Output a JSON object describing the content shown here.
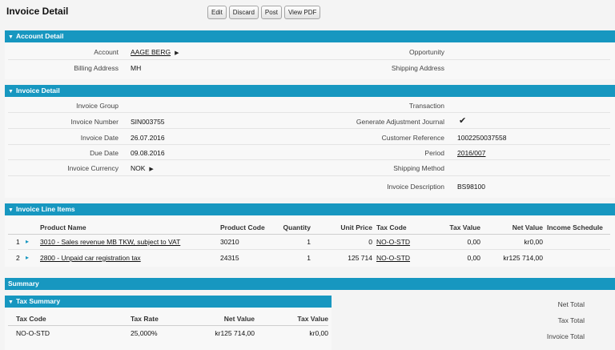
{
  "page": {
    "title": "Invoice Detail",
    "buttons": {
      "edit": "Edit",
      "discard": "Discard",
      "post": "Post",
      "view_pdf": "View PDF"
    }
  },
  "account_detail": {
    "header": "Account Detail",
    "account_label": "Account",
    "account_value": "AAGE BERG",
    "billing_label": "Billing Address",
    "billing_value": "MH",
    "opportunity_label": "Opportunity",
    "shipping_address_label": "Shipping Address"
  },
  "invoice_detail": {
    "header": "Invoice Detail",
    "group_label": "Invoice Group",
    "number_label": "Invoice Number",
    "number_value": "SIN003755",
    "date_label": "Invoice Date",
    "date_value": "26.07.2016",
    "due_label": "Due Date",
    "due_value": "09.08.2016",
    "currency_label": "Invoice Currency",
    "currency_value": "NOK",
    "transaction_label": "Transaction",
    "gen_adj_label": "Generate Adjustment Journal",
    "cust_ref_label": "Customer Reference",
    "cust_ref_value": "1002250037558",
    "period_label": "Period",
    "period_value": "2016/007",
    "ship_method_label": "Shipping Method",
    "description_label": "Invoice Description",
    "description_value": "BS98100"
  },
  "line_items": {
    "header": "Invoice Line Items",
    "columns": {
      "product_name": "Product Name",
      "product_code": "Product Code",
      "quantity": "Quantity",
      "unit_price": "Unit Price",
      "tax_code": "Tax Code",
      "tax_value": "Tax Value",
      "net_value": "Net Value",
      "income_schedule": "Income Schedule"
    },
    "rows": [
      {
        "num": "1",
        "name": "3010 - Sales revenue MB TKW, subject to VAT",
        "code": "30210",
        "qty": "1",
        "unit_price": "0",
        "tax_code": "NO-O-STD",
        "tax_value": "0,00",
        "net_value": "kr0,00"
      },
      {
        "num": "2",
        "name": "2800 - Unpaid car registration tax",
        "code": "24315",
        "qty": "1",
        "unit_price": "125 714",
        "tax_code": "NO-O-STD",
        "tax_value": "0,00",
        "net_value": "kr125 714,00"
      }
    ]
  },
  "summary": {
    "header": "Summary",
    "tax_summary_header": "Tax Summary",
    "columns": {
      "tax_code": "Tax Code",
      "tax_rate": "Tax Rate",
      "net_value": "Net Value",
      "tax_value": "Tax Value"
    },
    "row": {
      "tax_code": "NO-O-STD",
      "tax_rate": "25,000%",
      "net_value": "kr125 714,00",
      "tax_value": "kr0,00"
    },
    "totals": {
      "net_total": "Net Total",
      "tax_total": "Tax Total",
      "invoice_total": "Invoice Total"
    }
  },
  "colors": {
    "section_header": "#1797c0",
    "background": "#f4f4f4"
  }
}
